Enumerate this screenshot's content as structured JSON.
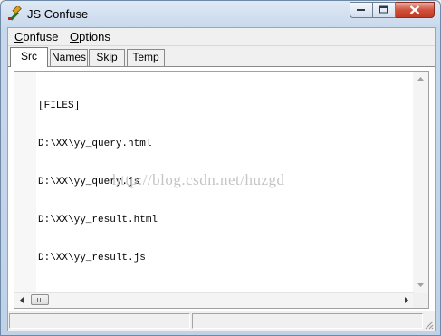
{
  "window": {
    "title": "JS Confuse",
    "icon": "hammer-icon"
  },
  "menu": {
    "items": [
      {
        "label": "Confuse",
        "access_key": "C",
        "rest": "onfuse"
      },
      {
        "label": "Options",
        "access_key": "O",
        "rest": "ptions"
      }
    ]
  },
  "tabs": [
    {
      "label": "Src",
      "active": true
    },
    {
      "label": "Names",
      "active": false
    },
    {
      "label": "Skip",
      "active": false
    },
    {
      "label": "Temp",
      "active": false
    }
  ],
  "editor": {
    "lines": [
      "[FILES]",
      "D:\\XX\\yy_query.html",
      "D:\\XX\\yy_query.js",
      "D:\\XX\\yy_result.html",
      "D:\\XX\\yy_result.js"
    ],
    "watermark": "http://blog.csdn.net/huzgd"
  },
  "statusbar": {
    "panes": [
      "",
      ""
    ]
  },
  "colors": {
    "close_button": "#c8442c",
    "frame": "#c4d5ea"
  }
}
